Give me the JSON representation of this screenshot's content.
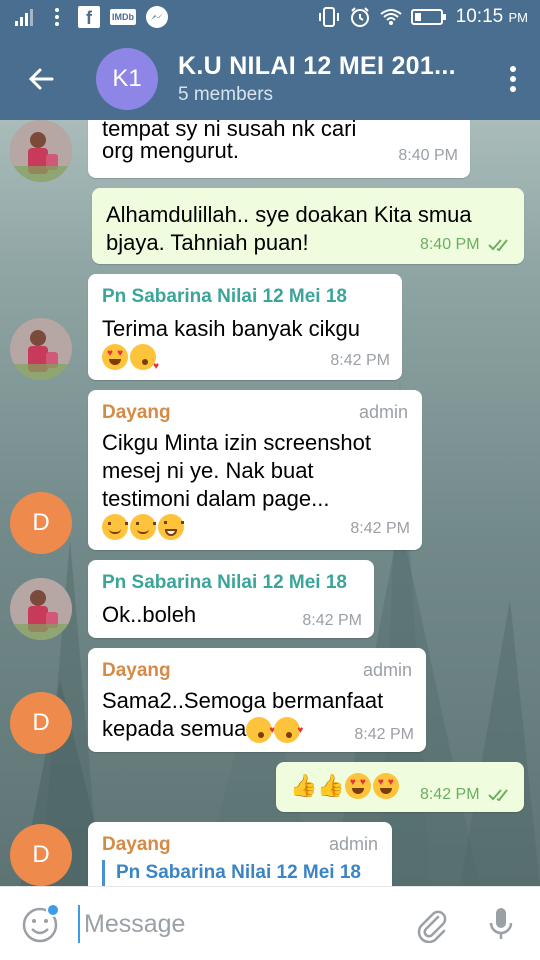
{
  "status_bar": {
    "time": "10:15",
    "ampm": "PM",
    "icons": [
      "signal-icon",
      "more-dots-icon",
      "facebook-icon",
      "imdb-icon",
      "messenger-icon",
      "vibrate-icon",
      "alarm-icon",
      "wifi-icon",
      "battery-icon"
    ],
    "imdb_label": "IMDb"
  },
  "header": {
    "avatar_initials": "K1",
    "avatar_color": "#8e86e6",
    "title": "K.U NILAI 12 MEI 201...",
    "subtitle": "5 members",
    "bar_color": "#4a6e8f"
  },
  "messages": [
    {
      "type": "in",
      "text1": "tempat sy ni susah nk cari",
      "text2": "org mengurut.",
      "time": "8:40 PM"
    },
    {
      "type": "out",
      "text1": "Alhamdulillah.. sye doakan Kita smua",
      "text2": "bjaya. Tahniah puan!",
      "time": "8:40 PM"
    },
    {
      "type": "in",
      "sender": "Pn Sabarina Nilai 12 Mei 18",
      "text1": "Terima kasih banyak cikgu",
      "time": "8:42 PM"
    },
    {
      "type": "in",
      "sender": "Dayang",
      "role": "admin",
      "text1": "Cikgu Minta izin screenshot",
      "text2": "mesej ni ye. Nak buat",
      "text3": "testimoni dalam page...",
      "time": "8:42 PM",
      "avatar": "D"
    },
    {
      "type": "in",
      "sender": "Pn Sabarina Nilai 12 Mei 18",
      "text1": "Ok..boleh",
      "time": "8:42 PM"
    },
    {
      "type": "in",
      "sender": "Dayang",
      "role": "admin",
      "text1": "Sama2..Semoga bermanfaat",
      "text2": "kepada semua",
      "time": "8:42 PM",
      "avatar": "D"
    },
    {
      "type": "out",
      "time": "8:42 PM"
    },
    {
      "type": "in",
      "sender": "Dayang",
      "role": "admin",
      "reply_to": "Pn Sabarina Nilai 12 Mei 18",
      "avatar": "D"
    }
  ],
  "colors": {
    "sender_green": "#3ba59a",
    "sender_orange": "#d58a46",
    "out_bubble": "#effdde",
    "read_ticks": "#6cae5f",
    "reply_blue": "#3b84c5",
    "letter_avatar": "#ee8a4c"
  },
  "input": {
    "placeholder": "Message",
    "icons": [
      "emoji-icon",
      "attach-icon",
      "mic-icon"
    ]
  }
}
